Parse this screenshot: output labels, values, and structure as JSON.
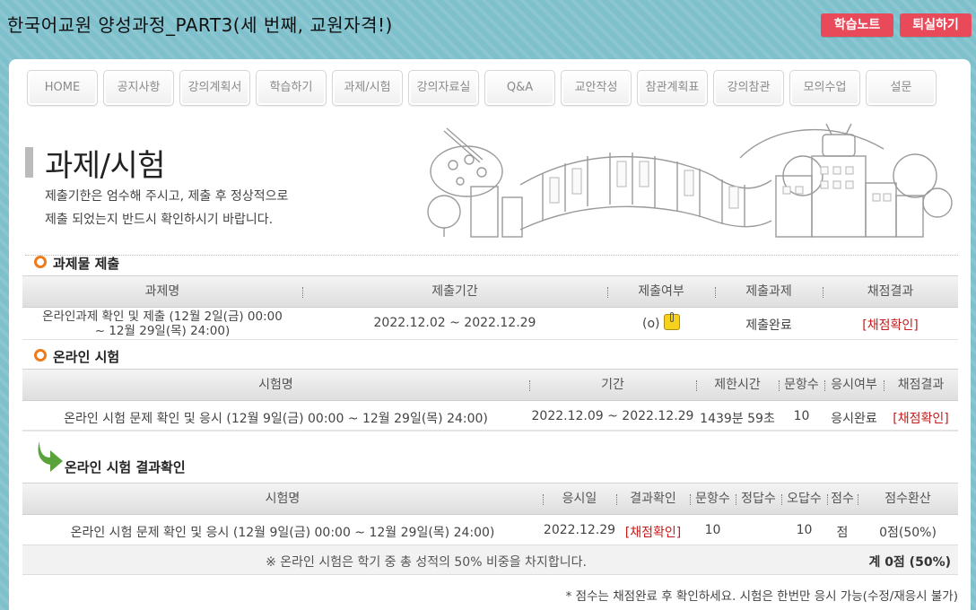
{
  "header": {
    "app_title": "한국어교원 양성과정_PART3(세 번째, 교원자격!)",
    "note_button": "학습노트",
    "exit_button": "퇴실하기"
  },
  "nav": [
    "HOME",
    "공지사항",
    "강의계획서",
    "학습하기",
    "과제/시험",
    "강의자료실",
    "Q&A",
    "교안작성",
    "참관계획표",
    "강의참관",
    "모의수업",
    "설문"
  ],
  "page": {
    "title": "과제/시험",
    "desc_line1": "제출기한은 엄수해 주시고, 제출 후 정상적으로",
    "desc_line2": "제출 되었는지 반드시 확인하시기 바랍니다."
  },
  "assignment": {
    "section_title": "과제물 제출",
    "columns": [
      "과제명",
      "제출기간",
      "제출여부",
      "제출과제",
      "채점결과"
    ],
    "row": {
      "name_line1": "온라인과제 확인 및 제출 (12월 2일(금) 00:00",
      "name_line2": "~ 12월 29일(목) 24:00)",
      "period": "2022.12.02 ~ 2022.12.29",
      "submitted": "(o)",
      "status": "제출완료",
      "result": "[채점확인]"
    }
  },
  "exam": {
    "section_title": "온라인 시험",
    "columns": [
      "시험명",
      "기간",
      "제한시간",
      "문항수",
      "응시여부",
      "채점결과"
    ],
    "row": {
      "name": "온라인 시험 문제 확인 및 응시 (12월 9일(금) 00:00 ~ 12월 29일(목) 24:00)",
      "period": "2022.12.09 ~ 2022.12.29",
      "time_limit": "1439분 59초",
      "questions": "10",
      "status": "응시완료",
      "result": "[채점확인]"
    }
  },
  "exam_result": {
    "section_title": "온라인 시험 결과확인",
    "columns": [
      "시험명",
      "응시일",
      "결과확인",
      "문항수",
      "정답수",
      "오답수",
      "점수",
      "점수환산"
    ],
    "row": {
      "name": "온라인 시험 문제 확인 및 응시 (12월 9일(금) 00:00 ~ 12월 29일(목) 24:00)",
      "date": "2022.12.29",
      "result": "[채점확인]",
      "questions": "10",
      "correct": "",
      "wrong": "10",
      "score": "점",
      "converted": "0점(50%)"
    },
    "note": "※ 온라인 시험은 학기 중 총 성적의 50% 비중을 차지합니다.",
    "total": "계 0점 (50%)",
    "footnote": "* 점수는 채점완료 후 확인하세요. 시험은 한번만 응시 가능(수정/재응시 불가)"
  },
  "colors": {
    "accent": "#ef7a1a",
    "button": "#e94a59",
    "result": "#c41b1b",
    "arrow": "#5aa23a"
  }
}
